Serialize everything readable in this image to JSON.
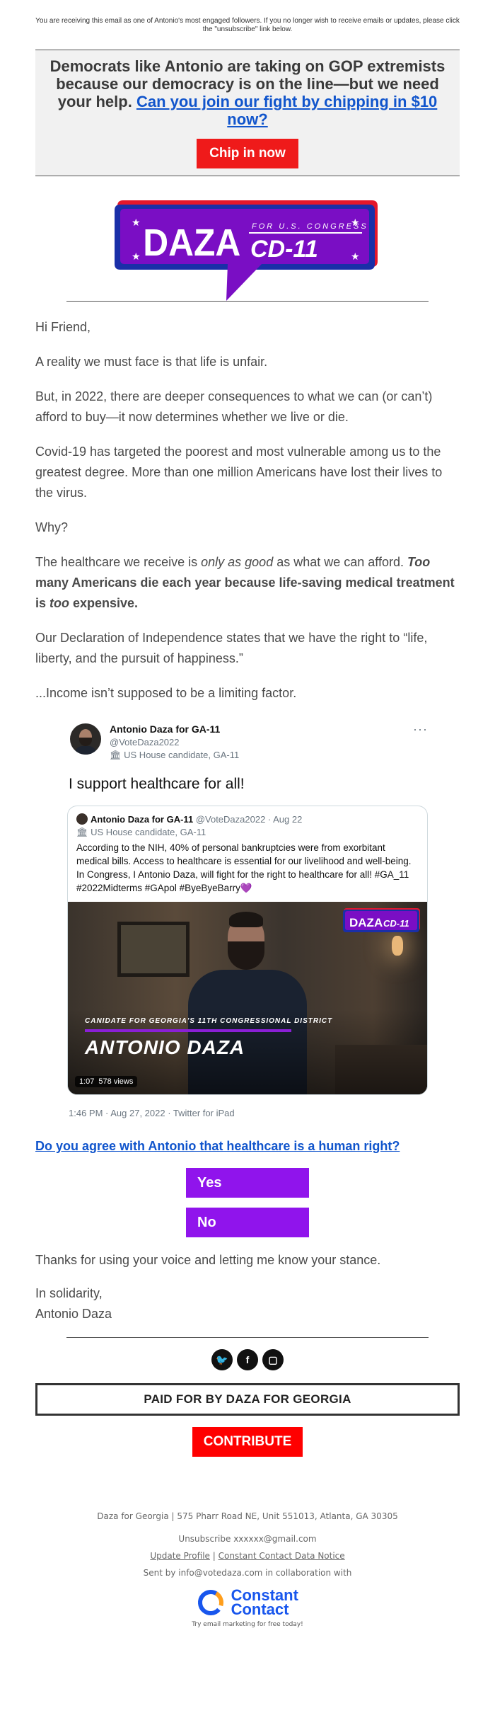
{
  "preheader": "You are receiving this email as one of Antonio's most engaged followers. If you no longer wish to receive emails or updates, please click the \"unsubscribe\" link below.",
  "banner": {
    "text": "Democrats like Antonio are taking on GOP extremists because our democracy is on the line—but we need your help.",
    "link": "Can you join our fight by chipping in $10 now?",
    "button": "Chip in now"
  },
  "logo": {
    "line1": "FOR U.S. CONGRESS",
    "name": "DAZA",
    "district": "CD-11",
    "colors": {
      "purple": "#7a0ec4",
      "blue": "#1a2fa8",
      "red": "#e4172b"
    }
  },
  "body": {
    "greeting": "Hi Friend,",
    "p1": "A reality we must face is that life is unfair.",
    "p2": "But, in 2022, there are deeper consequences to what we can (or can’t) afford to buy—it now determines whether we live or die.",
    "p3": "Covid-19 has targeted the poorest and most vulnerable among us to the greatest degree. More than one million Americans have lost their lives to the virus.",
    "p4": "Why?",
    "p5a": "The healthcare we receive is ",
    "p5b": "only as good",
    "p5c": " as what we can afford. ",
    "p5d": "Too",
    "p5e": " many Americans die each year because life-saving medical treatment is ",
    "p5f": "too",
    "p5g": " expensive.",
    "p6": "Our Declaration of Independence states that we have the right to “life, liberty, and the pursuit of happiness.”",
    "p7": "...Income isn’t supposed to be a limiting factor."
  },
  "tweet": {
    "name": "Antonio Daza for GA-11",
    "handle": "@VoteDaza2022",
    "label": "US House candidate, GA-11",
    "text": "I support healthcare for all!",
    "quoted": {
      "name": "Antonio Daza for GA-11",
      "meta": "@VoteDaza2022 · Aug 22",
      "label": "US House candidate, GA-11",
      "text": "According to the NIH, 40% of personal bankruptcies were from exorbitant medical bills. Access to healthcare is essential for our livelihood and well-being. In Congress, I Antonio Daza, will fight for the right to healthcare for all! #GA_11 #2022Midterms #GApol #ByeByeBarry💜",
      "video": {
        "subtitle": "CANIDATE FOR GEORGIA'S 11TH CONGRESSIONAL DISTRICT",
        "name": "ANTONIO DAZA",
        "duration": "1:07",
        "views": "578 views"
      }
    },
    "footer": "1:46 PM · Aug 27, 2022 · Twitter for iPad"
  },
  "poll": {
    "question": "Do you agree with Antonio that healthcare is a human right?",
    "yes": "Yes",
    "no": "No"
  },
  "closing": {
    "thanks": "Thanks for using your voice and letting me know your stance.",
    "signoff": "In solidarity,",
    "signature": "Antonio Daza"
  },
  "paid_for": "PAID FOR BY DAZA FOR GEORGIA",
  "contribute": "CONTRIBUTE",
  "footer": {
    "address": "Daza for Georgia | 575 Pharr Road NE, Unit 551013, Atlanta, GA 30305",
    "unsubscribe": "Unsubscribe xxxxxx@gmail.com",
    "update_profile": "Update Profile",
    "separator": " | ",
    "data_notice": "Constant Contact Data Notice",
    "sent_by": "Sent by info@votedaza.com in collaboration with",
    "cc_line1": "Constant",
    "cc_line2": "Contact",
    "cc_tagline": "Try email marketing for free today!"
  }
}
